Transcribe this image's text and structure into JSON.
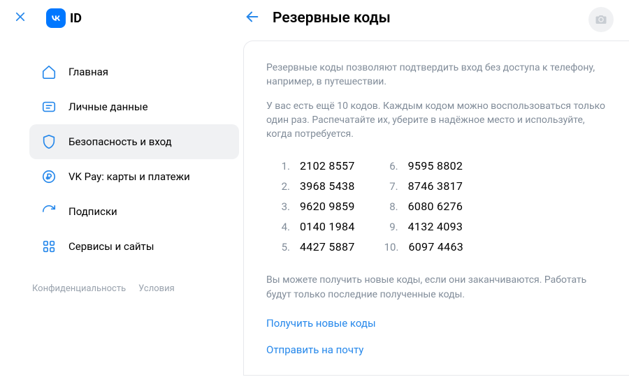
{
  "brand": {
    "id_text": "ID"
  },
  "header": {
    "title": "Резервные коды"
  },
  "sidebar": {
    "items": [
      {
        "label": "Главная"
      },
      {
        "label": "Личные данные"
      },
      {
        "label": "Безопасность и вход"
      },
      {
        "label": "VK Pay: карты и платежи"
      },
      {
        "label": "Подписки"
      },
      {
        "label": "Сервисы и сайты"
      }
    ],
    "footer": {
      "privacy": "Конфиденциальность",
      "terms": "Условия"
    }
  },
  "main": {
    "desc1": "Резервные коды позволяют подтвердить вход без доступа к телефону, например, в путешествии.",
    "desc2": "У вас есть ещё 10 кодов. Каждым кодом можно воспользоваться только один раз. Распечатайте их, уберите в надёжное место и используйте, когда потребуется.",
    "codes": [
      "2102 8557",
      "3968 5438",
      "9620 9859",
      "0140 1984",
      "4427 5887",
      "9595 8802",
      "8746 3817",
      "6080 6276",
      "4132 4093",
      "6097 4463"
    ],
    "note": "Вы можете получить новые коды, если они заканчиваются. Работать будут только последние полученные коды.",
    "action_generate": "Получить новые коды",
    "action_email": "Отправить на почту"
  }
}
